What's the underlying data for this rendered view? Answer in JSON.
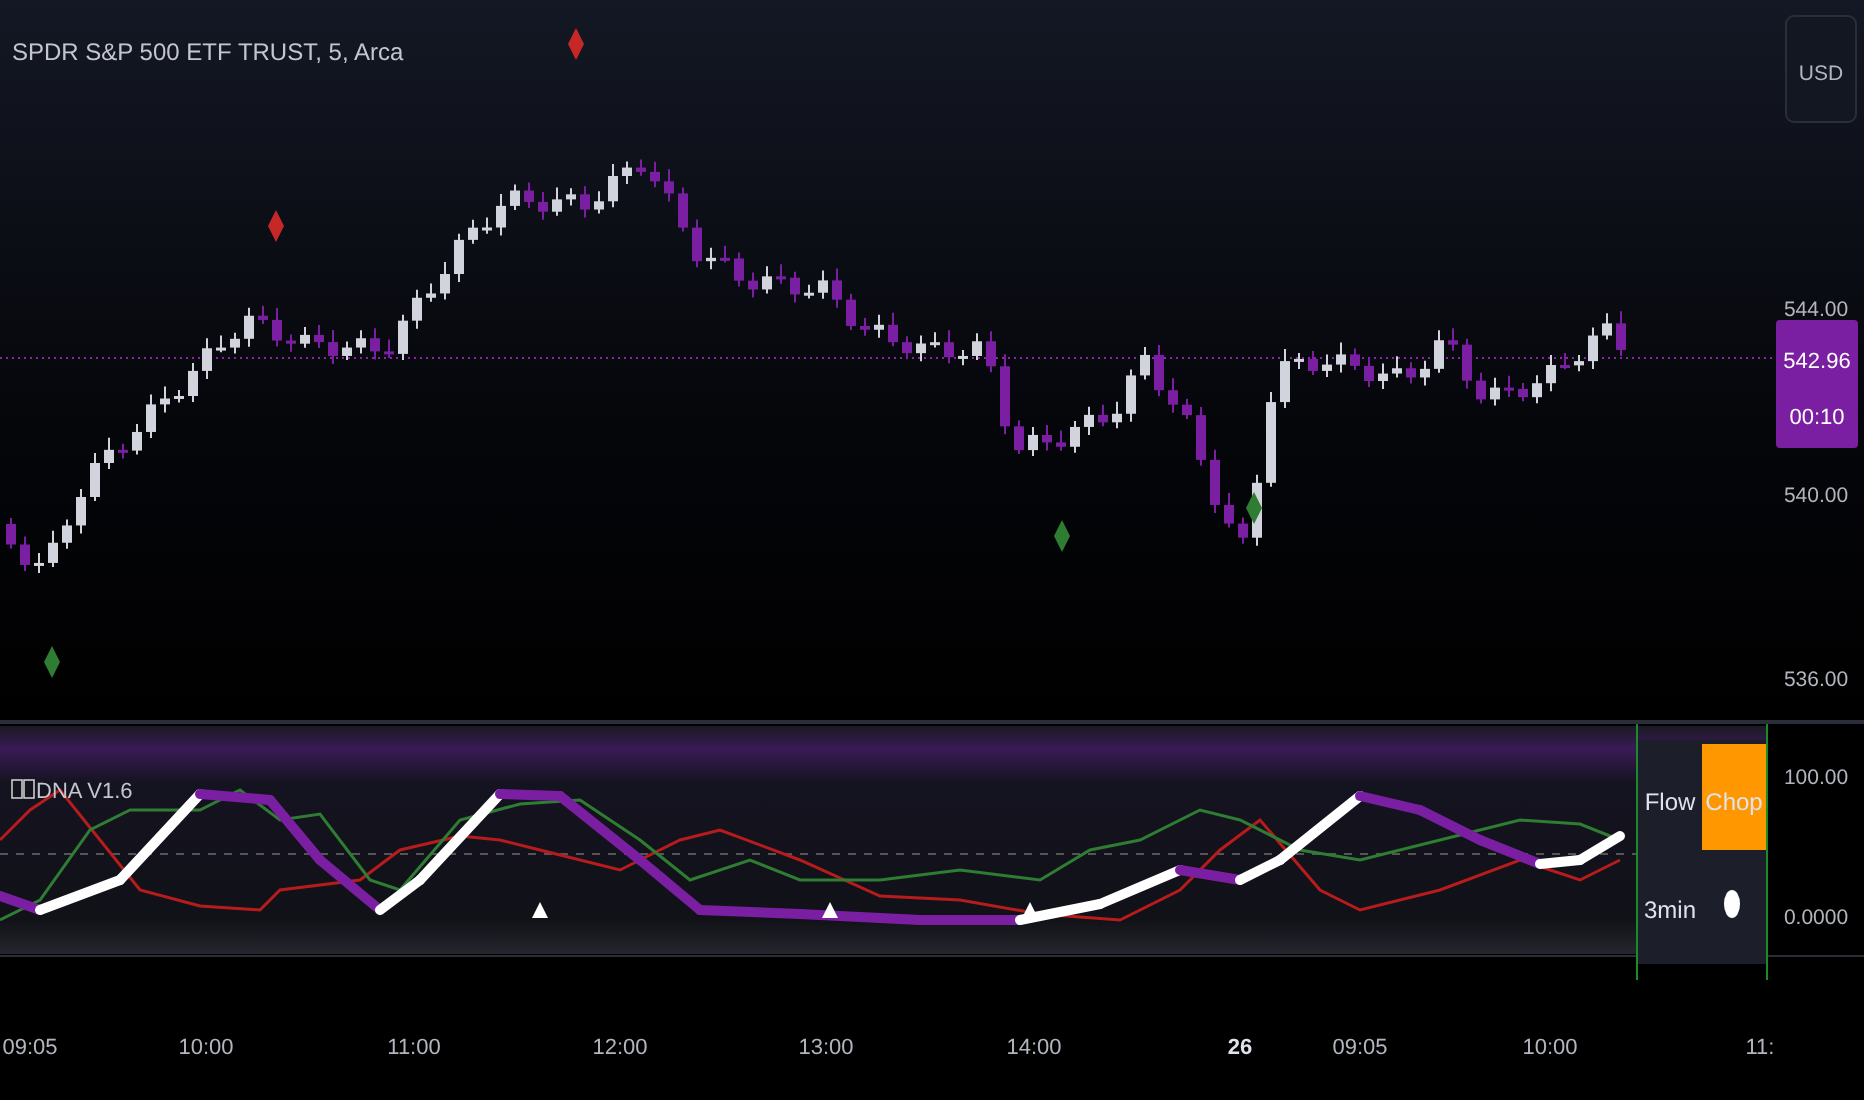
{
  "symbol_title": "SPDR S&P 500 ETF TRUST, 5, Arca",
  "currency_button": "USD",
  "price_axis": {
    "ticks": [
      "544.00",
      "540.00",
      "536.00"
    ],
    "last_price": "542.96",
    "countdown": "00:10"
  },
  "indicator": {
    "title": "DNA V1.6",
    "axis_ticks": [
      "100.00",
      "0.0000"
    ],
    "table": [
      {
        "label": "Flow",
        "kind": "text",
        "value": "Chop",
        "color": "#ff9800"
      },
      {
        "label": "3min",
        "kind": "dot",
        "color": "#ffffff"
      }
    ]
  },
  "time_axis": [
    {
      "label": "09:05",
      "bold": false
    },
    {
      "label": "10:00",
      "bold": false
    },
    {
      "label": "11:00",
      "bold": false
    },
    {
      "label": "12:00",
      "bold": false
    },
    {
      "label": "13:00",
      "bold": false
    },
    {
      "label": "14:00",
      "bold": false
    },
    {
      "label": "26",
      "bold": true
    },
    {
      "label": "09:05",
      "bold": false
    },
    {
      "label": "10:00",
      "bold": false
    },
    {
      "label": "11:",
      "bold": false
    }
  ]
}
